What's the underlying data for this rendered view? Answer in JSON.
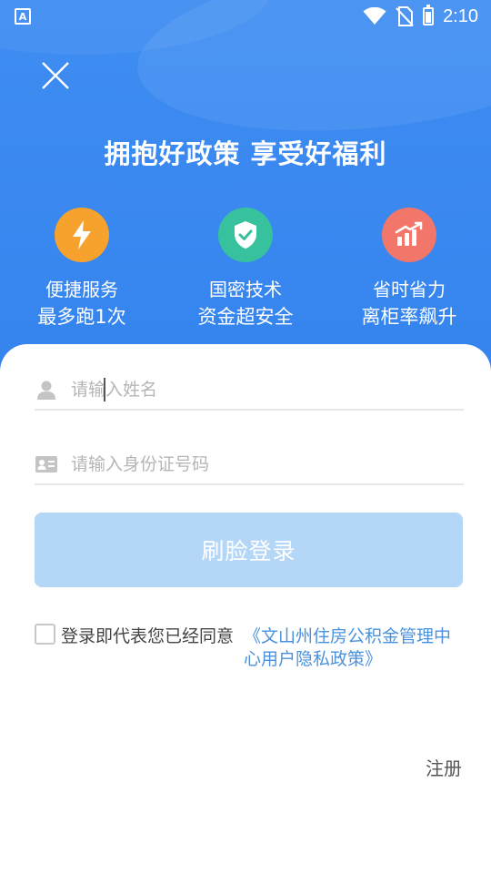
{
  "status_bar": {
    "app_badge": "A",
    "time": "2:10"
  },
  "header": {
    "slogan": "拥抱好政策 享受好福利"
  },
  "features": [
    {
      "line1": "便捷服务",
      "line2": "最多跑1次",
      "icon": "lightning-icon",
      "color": "#f7a22d"
    },
    {
      "line1": "国密技术",
      "line2": "资金超安全",
      "icon": "shield-check-icon",
      "color": "#37c29d"
    },
    {
      "line1": "省时省力",
      "line2": "离柜率飙升",
      "icon": "chart-growth-icon",
      "color": "#f2776a"
    }
  ],
  "form": {
    "name_placeholder": "请输入姓名",
    "id_placeholder": "请输入身份证号码",
    "login_label": "刷脸登录",
    "agree_text": "登录即代表您已经同意",
    "policy_line1": "《文山州住房公积金管理中",
    "policy_line2": "心用户隐私政策》",
    "register_label": "注册"
  },
  "colors": {
    "primary_blue": "#3a89f0",
    "button_disabled": "#b4d6f7",
    "link": "#4a92de"
  }
}
